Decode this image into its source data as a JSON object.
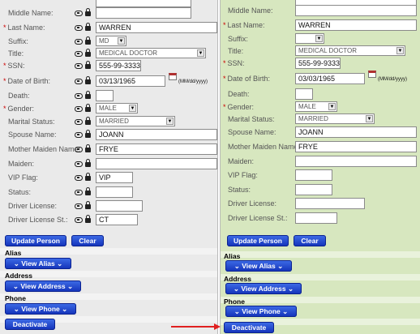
{
  "left": {
    "middle_name": {
      "label": "Middle Name:",
      "value": ""
    },
    "last_name": {
      "label": "Last Name:",
      "value": "WARREN"
    },
    "suffix": {
      "label": "Suffix:",
      "value": "MD"
    },
    "title": {
      "label": "Title:",
      "value": "MEDICAL DOCTOR"
    },
    "ssn": {
      "label": "SSN:",
      "value": "555-99-3333"
    },
    "dob": {
      "label": "Date of Birth:",
      "value": "03/13/1965",
      "format": "(MM/dd/yyyy)"
    },
    "death": {
      "label": "Death:",
      "value": ""
    },
    "gender": {
      "label": "Gender:",
      "value": "MALE"
    },
    "marital": {
      "label": "Marital Status:",
      "value": "MARRIED"
    },
    "spouse": {
      "label": "Spouse Name:",
      "value": "JOANN"
    },
    "mother_maiden": {
      "label": "Mother Maiden Name:",
      "value": "FRYE"
    },
    "maiden": {
      "label": "Maiden:",
      "value": ""
    },
    "vip": {
      "label": "VIP Flag:",
      "value": "VIP"
    },
    "status": {
      "label": "Status:",
      "value": ""
    },
    "driver_license": {
      "label": "Driver License:",
      "value": ""
    },
    "driver_license_st": {
      "label": "Driver License St.:",
      "value": "CT"
    },
    "buttons": {
      "update": "Update Person",
      "clear": "Clear",
      "alias": "View Alias",
      "address": "View Address",
      "phone": "View Phone",
      "deactivate": "Deactivate"
    },
    "sections": {
      "alias": "Alias",
      "address": "Address",
      "phone": "Phone"
    }
  },
  "right": {
    "middle_name": {
      "label": "Middle Name:",
      "value": ""
    },
    "last_name": {
      "label": "Last Name:",
      "value": "WARREN"
    },
    "suffix": {
      "label": "Suffix:",
      "value": ""
    },
    "title": {
      "label": "Title:",
      "value": "MEDICAL DOCTOR"
    },
    "ssn": {
      "label": "SSN:",
      "value": "555-99-9333"
    },
    "dob": {
      "label": "Date of Birth:",
      "value": "03/03/1965",
      "format": "(MM/dd/yyyy)"
    },
    "death": {
      "label": "Death:",
      "value": ""
    },
    "gender": {
      "label": "Gender:",
      "value": "MALE"
    },
    "marital": {
      "label": "Marital Status:",
      "value": "MARRIED"
    },
    "spouse": {
      "label": "Spouse Name:",
      "value": "JOANN"
    },
    "mother_maiden": {
      "label": "Mother Maiden Name:",
      "value": "FRYE"
    },
    "maiden": {
      "label": "Maiden:",
      "value": ""
    },
    "vip": {
      "label": "VIP Flag:",
      "value": ""
    },
    "status": {
      "label": "Status:",
      "value": ""
    },
    "driver_license": {
      "label": "Driver License:",
      "value": ""
    },
    "driver_license_st": {
      "label": "Driver License St.:",
      "value": ""
    },
    "buttons": {
      "update": "Update Person",
      "clear": "Clear",
      "alias": "View Alias",
      "address": "View Address",
      "phone": "View Phone",
      "deactivate": "Deactivate"
    },
    "sections": {
      "alias": "Alias",
      "address": "Address",
      "phone": "Phone"
    }
  },
  "colors": {
    "left_bg": "#eaeaea",
    "right_bg": "#d7e7bf",
    "button": "#1d3fcf",
    "required": "#cc0000",
    "arrow": "#e02020"
  },
  "icons": [
    "link-icon",
    "lock-icon",
    "calendar-icon",
    "chevron-down-icon",
    "arrow-right-icon"
  ]
}
